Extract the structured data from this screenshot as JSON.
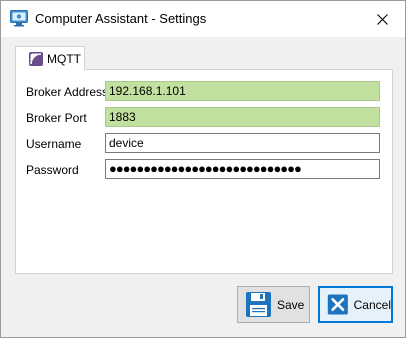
{
  "window": {
    "title": "Computer Assistant - Settings"
  },
  "tabs": [
    {
      "label": "MQTT",
      "icon": "mqtt-icon",
      "selected": true
    }
  ],
  "form": {
    "broker_address": {
      "label": "Broker Address",
      "value": "192.168.1.101"
    },
    "broker_port": {
      "label": "Broker Port",
      "value": "1883"
    },
    "username": {
      "label": "Username",
      "value": "device"
    },
    "password": {
      "label": "Password",
      "value": "●●●●●●●●●●●●●●●●●●●●●●●●●●●●"
    }
  },
  "buttons": {
    "save_label": "Save",
    "cancel_label": "Cancel"
  },
  "colors": {
    "highlight_field": "#c2e0a0",
    "focus_border": "#0078d7",
    "save_icon": "#1e73be",
    "cancel_icon": "#1e73be"
  }
}
